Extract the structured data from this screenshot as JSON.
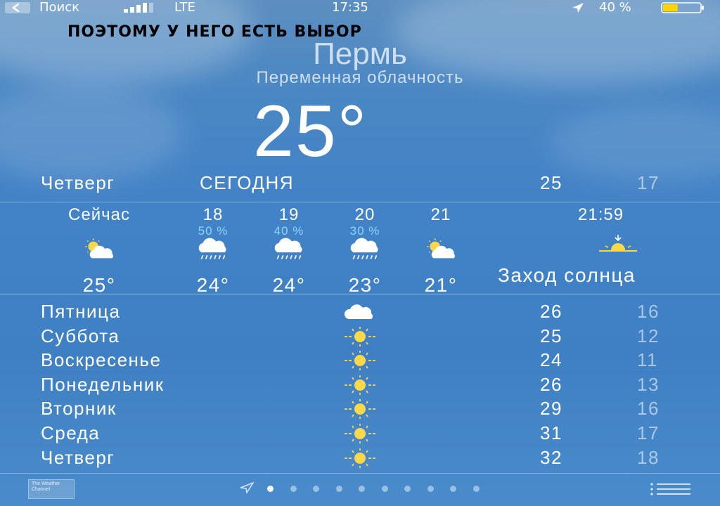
{
  "status_bar": {
    "back_label": "Поиск",
    "network": "LTE",
    "time": "17:35",
    "battery_percent": "40 %",
    "battery_level": 0.4,
    "battery_color": "#ffd400"
  },
  "caption": "ПОЭТОМУ У НЕГО ЕСТЬ ВЫБОР",
  "location": {
    "city": "Пермь",
    "condition": "Переменная облачность",
    "temperature": "25°"
  },
  "today": {
    "day": "Четверг",
    "label": "СЕГОДНЯ",
    "high": "25",
    "low": "17"
  },
  "hourly": [
    {
      "time": "Сейчас",
      "precip": "",
      "icon": "partly-cloudy-icon",
      "temp": "25°"
    },
    {
      "time": "18",
      "precip": "50 %",
      "icon": "rain-cloud-icon",
      "temp": "24°"
    },
    {
      "time": "19",
      "precip": "40 %",
      "icon": "rain-cloud-icon",
      "temp": "24°"
    },
    {
      "time": "20",
      "precip": "30 %",
      "icon": "rain-cloud-icon",
      "temp": "23°"
    },
    {
      "time": "21",
      "precip": "",
      "icon": "partly-cloudy-icon",
      "temp": "21°"
    }
  ],
  "sunset": {
    "time": "21:59",
    "label": "Заход солнца",
    "icon": "sunset-icon"
  },
  "daily": [
    {
      "day": "Пятница",
      "icon": "cloud-icon",
      "high": "26",
      "low": "16"
    },
    {
      "day": "Суббота",
      "icon": "sun-icon",
      "high": "25",
      "low": "12"
    },
    {
      "day": "Воскресенье",
      "icon": "sun-icon",
      "high": "24",
      "low": "11"
    },
    {
      "day": "Понедельник",
      "icon": "sun-icon",
      "high": "26",
      "low": "13"
    },
    {
      "day": "Вторник",
      "icon": "sun-icon",
      "high": "29",
      "low": "16"
    },
    {
      "day": "Среда",
      "icon": "sun-icon",
      "high": "31",
      "low": "17"
    },
    {
      "day": "Четверг",
      "icon": "sun-icon",
      "high": "32",
      "low": "18"
    }
  ],
  "footer": {
    "logo_text": "The Weather Channel",
    "page_count": 10,
    "active_page": 0
  },
  "colors": {
    "sky": "#4282c6",
    "precip_text": "#8fd3ff",
    "sun": "#ffd84a",
    "caption": "#000000"
  }
}
